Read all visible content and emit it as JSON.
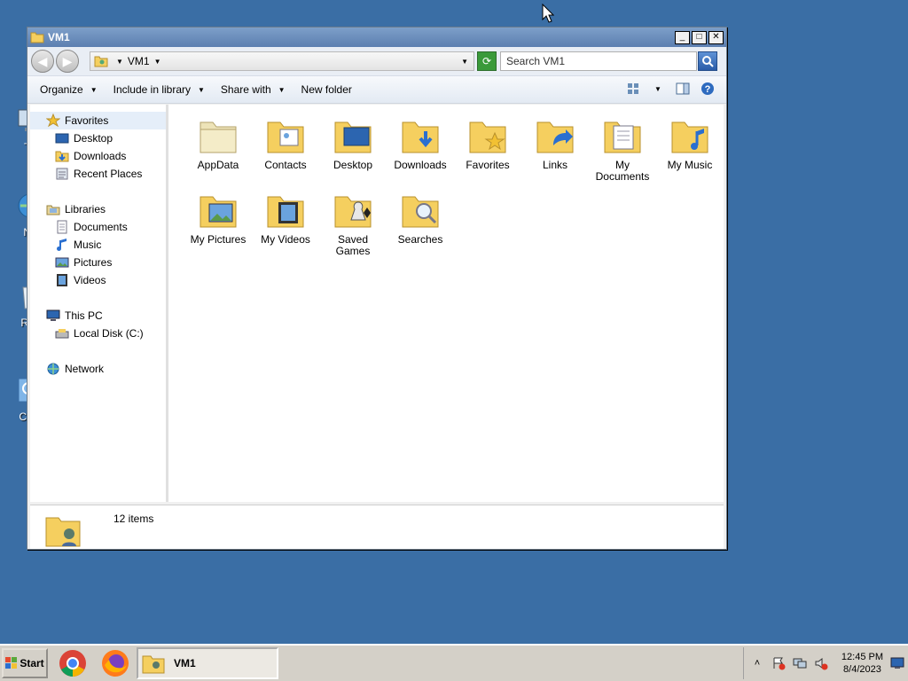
{
  "desktop": {
    "icons": [
      {
        "label": "Th",
        "icon": "this-pc-icon"
      },
      {
        "label": "Ne",
        "icon": "network-icon"
      },
      {
        "label": "Rec",
        "icon": "recycle-bin-icon"
      },
      {
        "label": "Cont",
        "icon": "control-panel-icon"
      }
    ]
  },
  "window": {
    "title": "VM1",
    "controls": {
      "minimize": "_",
      "maximize": "□",
      "close": "✕"
    },
    "address": {
      "crumb": "VM1"
    },
    "search": {
      "placeholder": "Search VM1"
    },
    "toolbar": {
      "organize": "Organize",
      "include": "Include in library",
      "share": "Share with",
      "new_folder": "New folder"
    },
    "nav": {
      "favorites": "Favorites",
      "desktop": "Desktop",
      "downloads": "Downloads",
      "recent": "Recent Places",
      "libraries": "Libraries",
      "documents": "Documents",
      "music": "Music",
      "pictures": "Pictures",
      "videos": "Videos",
      "thispc": "This PC",
      "localdisk": "Local Disk (C:)",
      "network": "Network"
    },
    "files": [
      {
        "label": "AppData",
        "icon": "appdata-folder-icon"
      },
      {
        "label": "Contacts",
        "icon": "contacts-folder-icon"
      },
      {
        "label": "Desktop",
        "icon": "desktop-folder-icon"
      },
      {
        "label": "Downloads",
        "icon": "downloads-folder-icon"
      },
      {
        "label": "Favorites",
        "icon": "favorites-folder-icon"
      },
      {
        "label": "Links",
        "icon": "links-folder-icon"
      },
      {
        "label": "My Documents",
        "icon": "documents-folder-icon"
      },
      {
        "label": "My Music",
        "icon": "music-folder-icon"
      },
      {
        "label": "My Pictures",
        "icon": "pictures-folder-icon"
      },
      {
        "label": "My Videos",
        "icon": "videos-folder-icon"
      },
      {
        "label": "Saved Games",
        "icon": "saved-games-folder-icon"
      },
      {
        "label": "Searches",
        "icon": "searches-folder-icon"
      }
    ],
    "status": {
      "count": "12 items"
    }
  },
  "taskbar": {
    "start": "Start",
    "task_label": "VM1",
    "clock": {
      "time": "12:45 PM",
      "date": "8/4/2023"
    }
  },
  "colors": {
    "desktop": "#3a6ea5",
    "titlebar": "#5c7fb0",
    "folder": "#f5cf5f"
  }
}
